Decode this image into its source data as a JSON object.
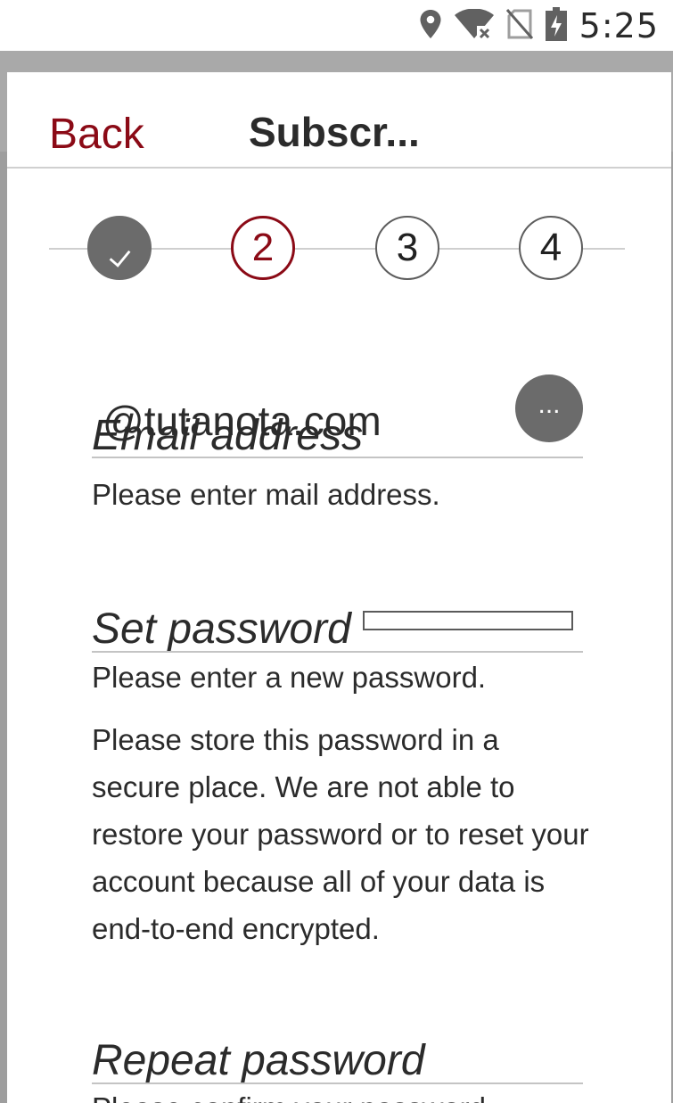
{
  "status_bar": {
    "time": "5:25",
    "icons": [
      "location-icon",
      "wifi-off-icon",
      "no-sim-icon",
      "battery-charging-icon"
    ]
  },
  "header": {
    "back_label": "Back",
    "title": "Subscr..."
  },
  "stepper": {
    "current_step": 2,
    "steps": [
      {
        "label": "",
        "state": "done"
      },
      {
        "label": "2",
        "state": "active"
      },
      {
        "label": "3",
        "state": "pending"
      },
      {
        "label": "4",
        "state": "pending"
      }
    ]
  },
  "form": {
    "email": {
      "label": "Email address",
      "value": "@tutanota.com",
      "help": "Please enter mail address.",
      "more_label": "..."
    },
    "password": {
      "label": "Set password",
      "value": "",
      "help": "Please enter a new password.",
      "warning": "Please store this password in a secure place. We are not able to restore your password or to reset your account because all of your data is end-to-end encrypted."
    },
    "repeat_password": {
      "label": "Repeat password",
      "help": "Please confirm your password."
    }
  },
  "colors": {
    "accent": "#8b0a16",
    "step_done": "#6b6b6b",
    "backdrop": "#9e9e9e"
  }
}
